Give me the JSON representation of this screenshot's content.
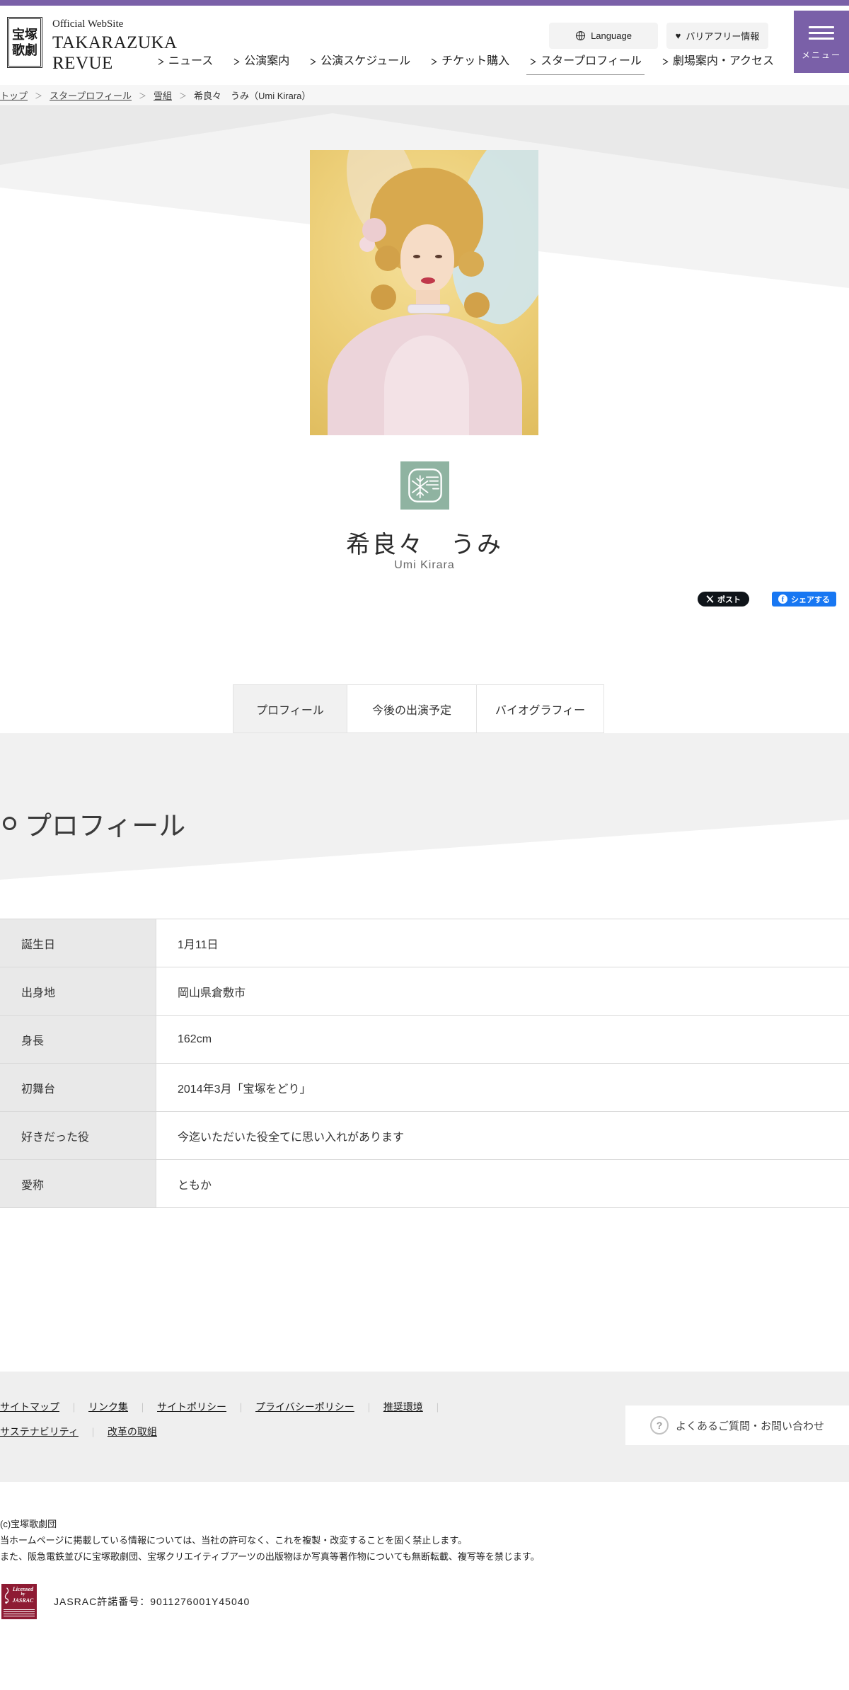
{
  "colors": {
    "accent_purple": "#7a60a8",
    "troupe_green": "#8fb3a1",
    "x_black": "#0f1419",
    "facebook_blue": "#1877f2",
    "jasrac_red": "#8e1b33",
    "section_gray": "#f1f1f1"
  },
  "icons": {
    "chevron_right": "＞",
    "heart": "♥",
    "question": "?",
    "facebook_f": "f"
  },
  "header": {
    "seal_line1": "宝塚",
    "seal_line2": "歌劇",
    "official": "Official WebSite",
    "brand_line1": "TAKARAZUKA",
    "brand_line2": "REVUE",
    "nav": [
      "ニュース",
      "公演案内",
      "公演スケジュール",
      "チケット購入",
      "スタープロフィール",
      "劇場案内・アクセス"
    ],
    "language_label": "Language",
    "barrier_free_label": "バリアフリー情報",
    "menu_label": "メニュー"
  },
  "breadcrumb": {
    "separator": "＞",
    "items": [
      "トップ",
      "スタープロフィール",
      "雪組"
    ],
    "current": "希良々　うみ（Umi Kirara）"
  },
  "star": {
    "name": "希良々　うみ",
    "romaji": "Umi Kirara",
    "troupe": "雪組"
  },
  "share": {
    "x_label": "ポスト",
    "fb_label": "シェアする"
  },
  "tabs": [
    {
      "label": "プロフィール",
      "active": true
    },
    {
      "label": "今後の出演予定",
      "active": false
    },
    {
      "label": "バイオグラフィー",
      "active": false
    }
  ],
  "section": {
    "title": "プロフィール"
  },
  "profile_table": {
    "rows": [
      {
        "label": "誕生日",
        "value": "1月11日"
      },
      {
        "label": "出身地",
        "value": "岡山県倉敷市"
      },
      {
        "label": "身長",
        "value": "162cm"
      },
      {
        "label": "初舞台",
        "value": "2014年3月「宝塚をどり」"
      },
      {
        "label": "好きだった役",
        "value": "今迄いただいた役全てに思い入れがあります"
      },
      {
        "label": "愛称",
        "value": "ともか"
      }
    ]
  },
  "footer": {
    "links_row1": [
      "サイトマップ",
      "リンク集",
      "サイトポリシー",
      "プライバシーポリシー",
      "推奨環境"
    ],
    "links_row2": [
      "サステナビリティ",
      "改革の取組"
    ],
    "separator": "｜",
    "faq_label": "よくあるご質問・お問い合わせ",
    "copyright_lines": [
      "(c)宝塚歌劇団",
      "当ホームページに掲載している情報については、当社の許可なく、これを複製・改変することを固く禁止します。",
      "また、阪急電鉄並びに宝塚歌劇団、宝塚クリエイティブアーツの出版物ほか写真等著作物についても無断転載、複写等を禁じます。"
    ],
    "jasrac": {
      "badge_line1": "Licensed",
      "badge_line2": "by",
      "badge_line3": "JASRAC",
      "number": "JASRAC許諾番号：9011276001Y45040"
    }
  }
}
